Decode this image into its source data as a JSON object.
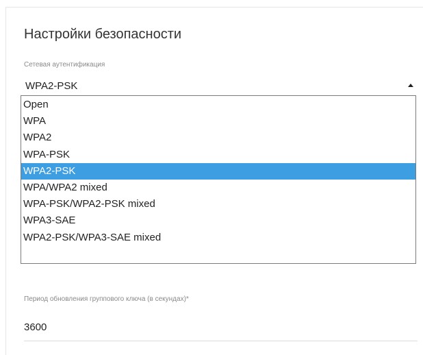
{
  "security": {
    "title": "Настройки безопасности",
    "auth_label": "Сетевая аутентификация",
    "auth_selected": "WPA2-PSK",
    "auth_options": [
      "Open",
      "WPA",
      "WPA2",
      "WPA-PSK",
      "WPA2-PSK",
      "WPA/WPA2 mixed",
      "WPA-PSK/WPA2-PSK mixed",
      "WPA3-SAE",
      "WPA2-PSK/WPA3-SAE mixed"
    ],
    "rekey_label": "Период обновления группового ключа (в секундах)*",
    "rekey_value": "3600"
  },
  "colors": {
    "highlight": "#3d9ee2",
    "text": "#222222",
    "label": "#8a8a8a"
  }
}
